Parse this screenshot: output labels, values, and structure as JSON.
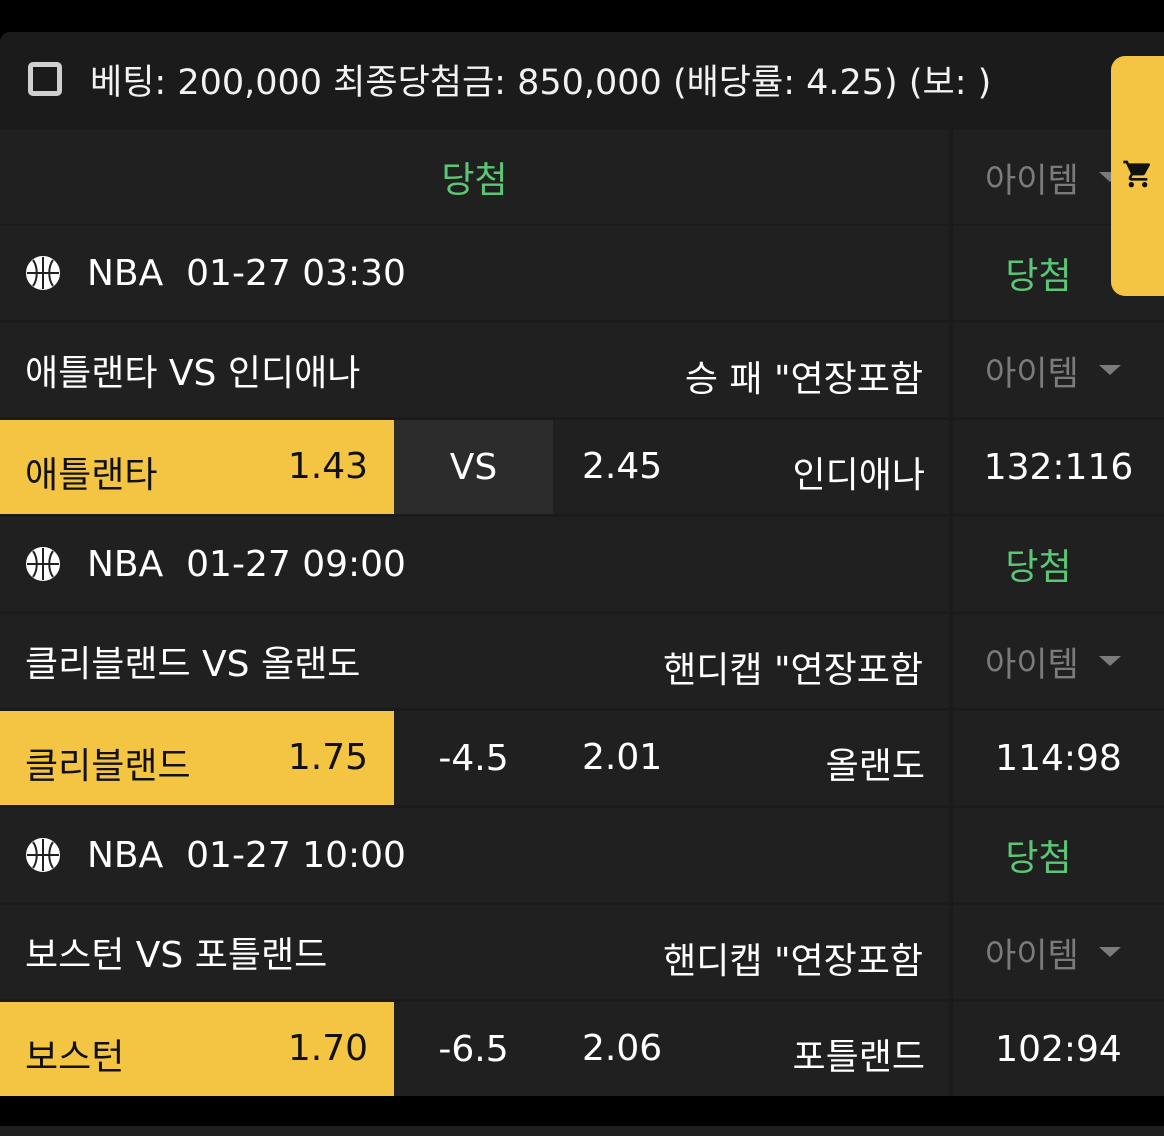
{
  "header": {
    "summary": "베팅: 200,000 최종당첨금: 850,000 (배당률: 4.25) (보: )"
  },
  "result_bar": {
    "status": "당첨",
    "item_label": "아이템"
  },
  "games": [
    {
      "league": "NBA",
      "datetime": "01-27 03:30",
      "status": "당첨",
      "matchup": "애틀랜타 VS 인디애나",
      "market": "승 패 \"연장포함",
      "item_label": "아이템",
      "home": "애틀랜타",
      "home_odds": "1.43",
      "mid": "VS",
      "away_odds": "2.45",
      "away": "인디애나",
      "score": "132:116"
    },
    {
      "league": "NBA",
      "datetime": "01-27 09:00",
      "status": "당첨",
      "matchup": "클리블랜드 VS 올랜도",
      "market": "핸디캡 \"연장포함",
      "item_label": "아이템",
      "home": "클리블랜드",
      "home_odds": "1.75",
      "mid": "-4.5",
      "away_odds": "2.01",
      "away": "올랜도",
      "score": "114:98"
    },
    {
      "league": "NBA",
      "datetime": "01-27 10:00",
      "status": "당첨",
      "matchup": "보스턴 VS 포틀랜드",
      "market": "핸디캡 \"연장포함",
      "item_label": "아이템",
      "home": "보스턴",
      "home_odds": "1.70",
      "mid": "-6.5",
      "away_odds": "2.06",
      "away": "포틀랜드",
      "score": "102:94"
    }
  ],
  "colors": {
    "accent_yellow": "#f4c542",
    "win_green": "#5bc776",
    "panel": "#202020"
  },
  "icons": {
    "checkbox": "checkbox-icon",
    "sport": "basketball-icon",
    "cart": "cart-icon",
    "dropdown": "chevron-down-icon"
  }
}
